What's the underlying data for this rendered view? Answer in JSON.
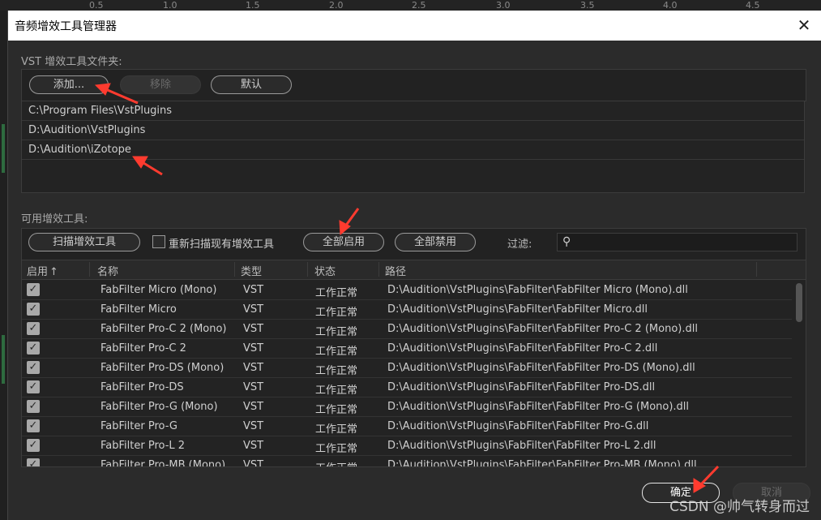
{
  "background": {
    "ruler_ticks": [
      "0.5",
      "1.0",
      "1.5",
      "2.0",
      "2.5",
      "3.0",
      "3.5",
      "4.0",
      "4.5"
    ]
  },
  "dialog": {
    "title": "音频增效工具管理器",
    "close_glyph": "✕"
  },
  "vst_section": {
    "label": "VST 增效工具文件夹:",
    "buttons": {
      "add": "添加...",
      "remove": "移除",
      "default": "默认"
    },
    "folders": [
      "C:\\Program Files\\VstPlugins",
      "D:\\Audition\\VstPlugins",
      "D:\\Audition\\iZotope"
    ]
  },
  "plugins_section": {
    "label": "可用增效工具:",
    "scan_button": "扫描增效工具",
    "rescan_label": "重新扫描现有增效工具",
    "enable_all": "全部启用",
    "disable_all": "全部禁用",
    "filter_label": "过滤:",
    "search_icon": "⚲",
    "columns": {
      "enabled": "启用",
      "sort_glyph": "↑",
      "name": "名称",
      "type": "类型",
      "status": "状态",
      "path": "路径"
    },
    "rows": [
      {
        "enabled": true,
        "name": "FabFilter Micro (Mono)",
        "type": "VST",
        "status": "工作正常",
        "path": "D:\\Audition\\VstPlugins\\FabFilter\\FabFilter Micro (Mono).dll"
      },
      {
        "enabled": true,
        "name": "FabFilter Micro",
        "type": "VST",
        "status": "工作正常",
        "path": "D:\\Audition\\VstPlugins\\FabFilter\\FabFilter Micro.dll"
      },
      {
        "enabled": true,
        "name": "FabFilter Pro-C 2 (Mono)",
        "type": "VST",
        "status": "工作正常",
        "path": "D:\\Audition\\VstPlugins\\FabFilter\\FabFilter Pro-C 2 (Mono).dll"
      },
      {
        "enabled": true,
        "name": "FabFilter Pro-C 2",
        "type": "VST",
        "status": "工作正常",
        "path": "D:\\Audition\\VstPlugins\\FabFilter\\FabFilter Pro-C 2.dll"
      },
      {
        "enabled": true,
        "name": "FabFilter Pro-DS (Mono)",
        "type": "VST",
        "status": "工作正常",
        "path": "D:\\Audition\\VstPlugins\\FabFilter\\FabFilter Pro-DS (Mono).dll"
      },
      {
        "enabled": true,
        "name": "FabFilter Pro-DS",
        "type": "VST",
        "status": "工作正常",
        "path": "D:\\Audition\\VstPlugins\\FabFilter\\FabFilter Pro-DS.dll"
      },
      {
        "enabled": true,
        "name": "FabFilter Pro-G (Mono)",
        "type": "VST",
        "status": "工作正常",
        "path": "D:\\Audition\\VstPlugins\\FabFilter\\FabFilter Pro-G (Mono).dll"
      },
      {
        "enabled": true,
        "name": "FabFilter Pro-G",
        "type": "VST",
        "status": "工作正常",
        "path": "D:\\Audition\\VstPlugins\\FabFilter\\FabFilter Pro-G.dll"
      },
      {
        "enabled": true,
        "name": "FabFilter Pro-L 2",
        "type": "VST",
        "status": "工作正常",
        "path": "D:\\Audition\\VstPlugins\\FabFilter\\FabFilter Pro-L 2.dll"
      },
      {
        "enabled": true,
        "name": "FabFilter Pro-MB (Mono)",
        "type": "VST",
        "status": "工作正常",
        "path": "D:\\Audition\\VstPlugins\\FabFilter\\FabFilter Pro-MB (Mono).dll"
      }
    ]
  },
  "footer": {
    "ok": "确定",
    "cancel": "取消"
  },
  "watermark": "CSDN @帅气转身而过",
  "colors": {
    "annotation_arrow": "#ff3b2f",
    "dialog_bg": "#2b2b2b",
    "panel_bg": "#222222",
    "checkbox": "#a8a8a8"
  }
}
